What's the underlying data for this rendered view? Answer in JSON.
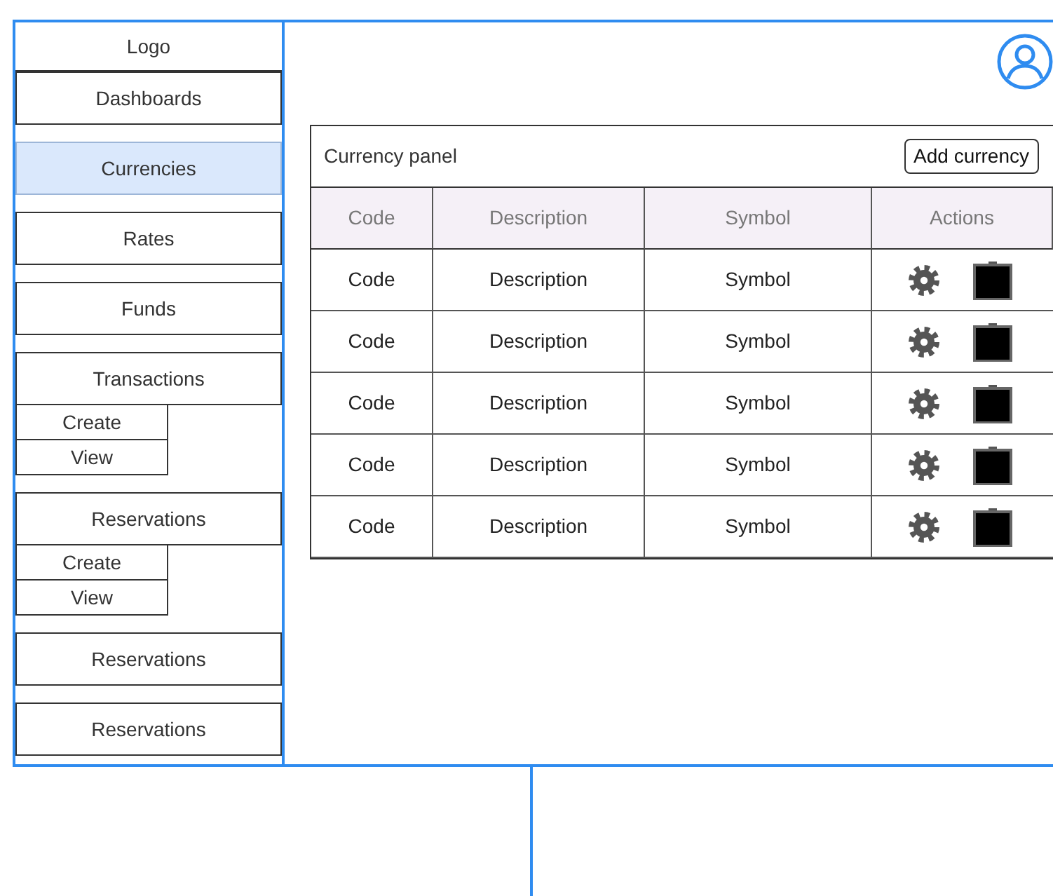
{
  "sidebar": {
    "logo": "Logo",
    "items": [
      {
        "label": "Dashboards",
        "selected": false
      },
      {
        "label": "Currencies",
        "selected": true
      },
      {
        "label": "Rates",
        "selected": false
      },
      {
        "label": "Funds",
        "selected": false
      },
      {
        "label": "Transactions",
        "selected": false,
        "children": [
          {
            "label": "Create"
          },
          {
            "label": "View"
          }
        ]
      },
      {
        "label": "Reservations",
        "selected": false,
        "children": [
          {
            "label": "Create"
          },
          {
            "label": "View"
          }
        ]
      },
      {
        "label": "Reservations",
        "selected": false
      },
      {
        "label": "Reservations",
        "selected": false
      }
    ]
  },
  "panel": {
    "title": "Currency panel",
    "add_button": "Add currency",
    "table": {
      "columns": [
        "Code",
        "Description",
        "Symbol",
        "Actions"
      ],
      "rows": [
        {
          "code": "Code",
          "description": "Description",
          "symbol": "Symbol"
        },
        {
          "code": "Code",
          "description": "Description",
          "symbol": "Symbol"
        },
        {
          "code": "Code",
          "description": "Description",
          "symbol": "Symbol"
        },
        {
          "code": "Code",
          "description": "Description",
          "symbol": "Symbol"
        },
        {
          "code": "Code",
          "description": "Description",
          "symbol": "Symbol"
        }
      ]
    }
  }
}
